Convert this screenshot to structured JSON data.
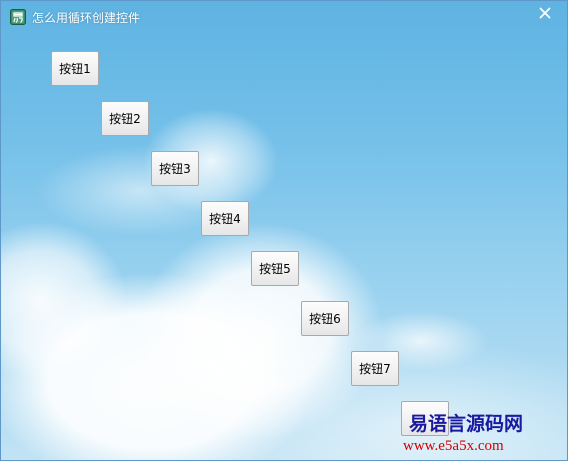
{
  "window": {
    "title": "怎么用循环创建控件",
    "icon": "app-logo-icon",
    "close_icon": "close-icon"
  },
  "buttons": [
    {
      "label": "按钮1"
    },
    {
      "label": "按钮2"
    },
    {
      "label": "按钮3"
    },
    {
      "label": "按钮4"
    },
    {
      "label": "按钮5"
    },
    {
      "label": "按钮6"
    },
    {
      "label": "按钮7"
    },
    {
      "label": ""
    }
  ],
  "watermark": {
    "title": "易语言源码网",
    "url": "www.e5a5x.com",
    "colors": {
      "title": "#1a1aa0",
      "url": "#d40000"
    }
  },
  "colors": {
    "sky_top": "#5fb3e2",
    "sky_bottom": "#c1e3f4",
    "window_border": "#5f98c8"
  }
}
